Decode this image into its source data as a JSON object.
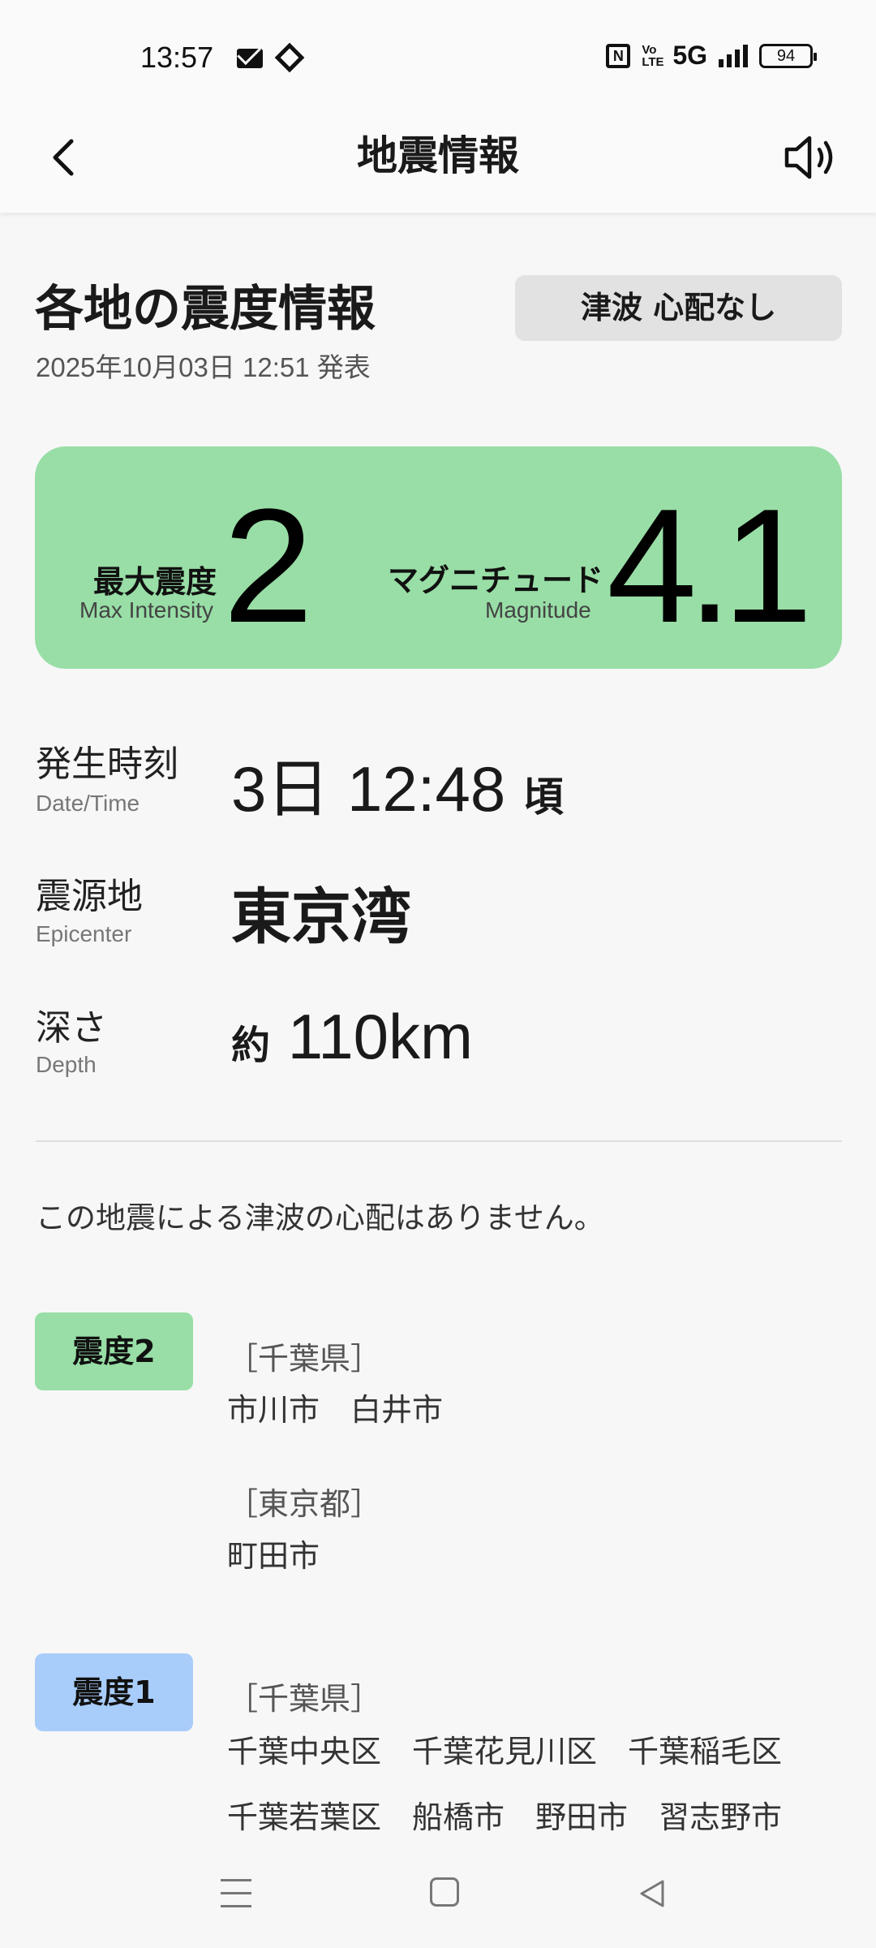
{
  "status_bar": {
    "time": "13:57",
    "network": "5G",
    "battery": "94",
    "volte": "Vo LTE",
    "nfc": "N"
  },
  "app_bar": {
    "title": "地震情報",
    "back_icon": "chevron-left-icon",
    "sound_icon": "speaker-icon"
  },
  "header": {
    "title": "各地の震度情報",
    "announced": "2025年10月03日 12:51 発表",
    "tsunami_badge": "津波 心配なし"
  },
  "summary": {
    "max_intensity_label_jp": "最大震度",
    "max_intensity_label_en": "Max Intensity",
    "max_intensity_value": "2",
    "magnitude_label_jp": "マグニチュード",
    "magnitude_label_en": "Magnitude",
    "magnitude_value": "4.1",
    "card_color": "#98dea6"
  },
  "details": {
    "datetime_label_jp": "発生時刻",
    "datetime_label_en": "Date/Time",
    "datetime_value": "3日 12:48",
    "datetime_suffix": "頃",
    "epicenter_label_jp": "震源地",
    "epicenter_label_en": "Epicenter",
    "epicenter_value": "東京湾",
    "depth_label_jp": "深さ",
    "depth_label_en": "Depth",
    "depth_prefix": "約",
    "depth_value": "110km"
  },
  "notice": "この地震による津波の心配はありません。",
  "intensity_groups": [
    {
      "label": "震度2",
      "color": "#98dea6",
      "prefectures": [
        {
          "name": "［千葉県］",
          "cities": [
            "市川市",
            "白井市"
          ]
        },
        {
          "name": "［東京都］",
          "cities": [
            "町田市"
          ]
        }
      ]
    },
    {
      "label": "震度1",
      "color": "#a9cdfa",
      "prefectures": [
        {
          "name": "［千葉県］",
          "cities": [
            "千葉中央区",
            "千葉花見川区",
            "千葉稲毛区",
            "千葉若葉区",
            "船橋市",
            "野田市",
            "習志野市"
          ]
        }
      ]
    }
  ],
  "nav_bar": {
    "menu_icon": "menu-icon",
    "home_icon": "home-icon",
    "back_icon": "back-triangle-icon"
  }
}
